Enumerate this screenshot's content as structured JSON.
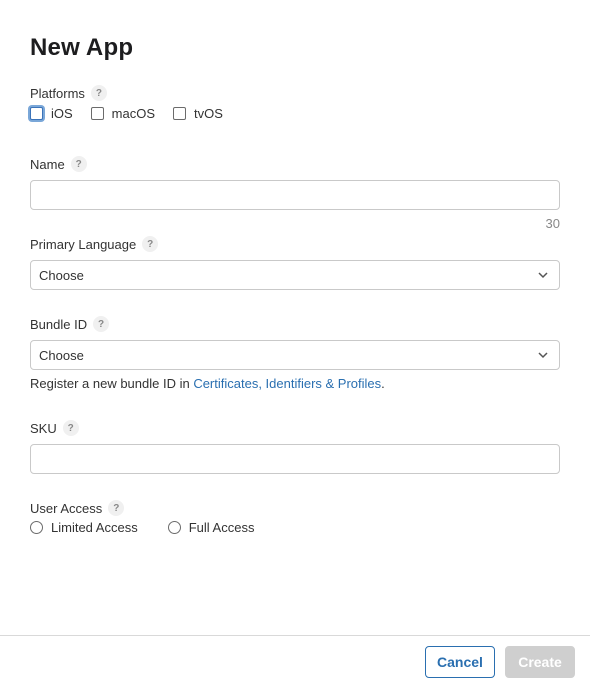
{
  "dialog": {
    "title": "New App"
  },
  "platforms": {
    "label": "Platforms",
    "help": "?",
    "options": [
      {
        "label": "iOS",
        "checked": false,
        "focused": true
      },
      {
        "label": "macOS",
        "checked": false
      },
      {
        "label": "tvOS",
        "checked": false
      }
    ]
  },
  "name": {
    "label": "Name",
    "help": "?",
    "value": "",
    "counter": "30"
  },
  "primary_language": {
    "label": "Primary Language",
    "help": "?",
    "selected": "Choose"
  },
  "bundle_id": {
    "label": "Bundle ID",
    "help": "?",
    "selected": "Choose",
    "register_prefix": "Register a new bundle ID in ",
    "register_link": "Certificates, Identifiers & Profiles",
    "register_suffix": "."
  },
  "sku": {
    "label": "SKU",
    "help": "?",
    "value": ""
  },
  "user_access": {
    "label": "User Access",
    "help": "?",
    "options": [
      {
        "label": "Limited Access",
        "selected": false
      },
      {
        "label": "Full Access",
        "selected": false
      }
    ]
  },
  "footer": {
    "cancel_label": "Cancel",
    "create_label": "Create"
  },
  "colors": {
    "link": "#2a6fb0",
    "create_disabled": "#cfcfcf",
    "focus_ring": "#7aa7d8"
  }
}
